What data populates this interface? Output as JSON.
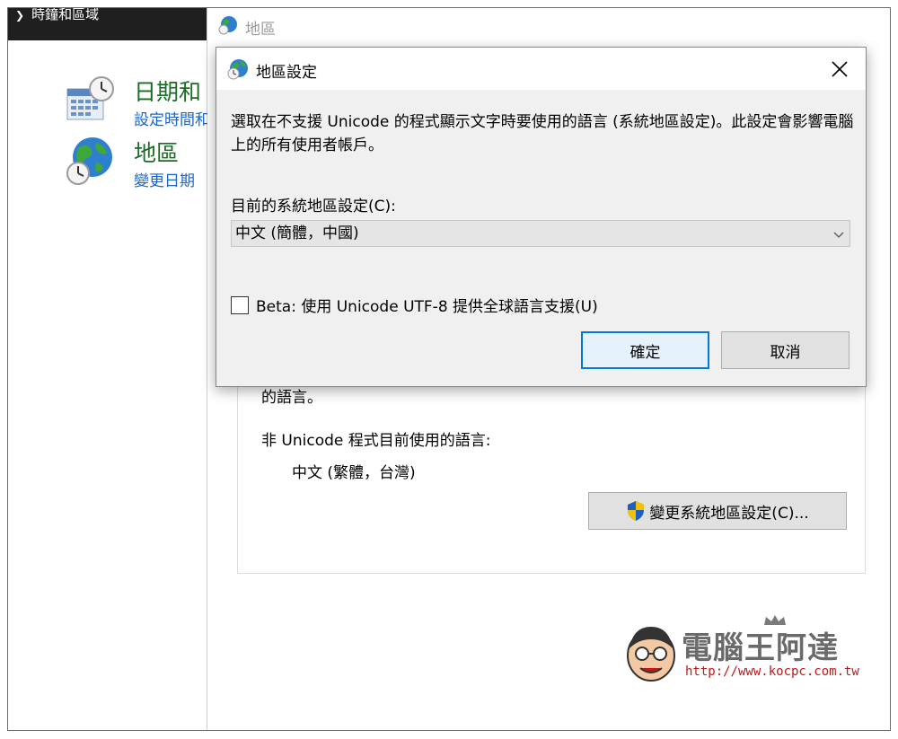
{
  "left_panel": {
    "topbar_title": "時鐘和區域",
    "items": [
      {
        "title": "日期和",
        "subtitle": "設定時間和",
        "icon": "calendar-clock-icon"
      },
      {
        "title": "地區",
        "subtitle": "變更日期",
        "icon": "globe-clock-icon"
      }
    ]
  },
  "region_window": {
    "title": "地區",
    "clipped_text": "的語言。",
    "non_unicode_label": "非 Unicode 程式目前使用的語言:",
    "non_unicode_value": "中文 (繁體，台灣)",
    "change_button_label": "變更系統地區設定(C)..."
  },
  "dialog": {
    "title": "地區設定",
    "description": "選取在不支援 Unicode 的程式顯示文字時要使用的語言 (系統地區設定)。此設定會影響電腦上的所有使用者帳戶。",
    "current_label": "目前的系統地區設定(C):",
    "current_value": "中文 (簡體，中國)",
    "beta_label": "Beta: 使用 Unicode UTF-8 提供全球語言支援(U)",
    "beta_checked": false,
    "ok_label": "確定",
    "cancel_label": "取消"
  },
  "watermark": {
    "title": "電腦王阿達",
    "url": "http://www.kocpc.com.tw"
  },
  "colors": {
    "link_blue": "#1e64c8",
    "heading_green": "#1b6b26",
    "accent_focus": "#0078d7",
    "watermark_red": "#c01818"
  }
}
